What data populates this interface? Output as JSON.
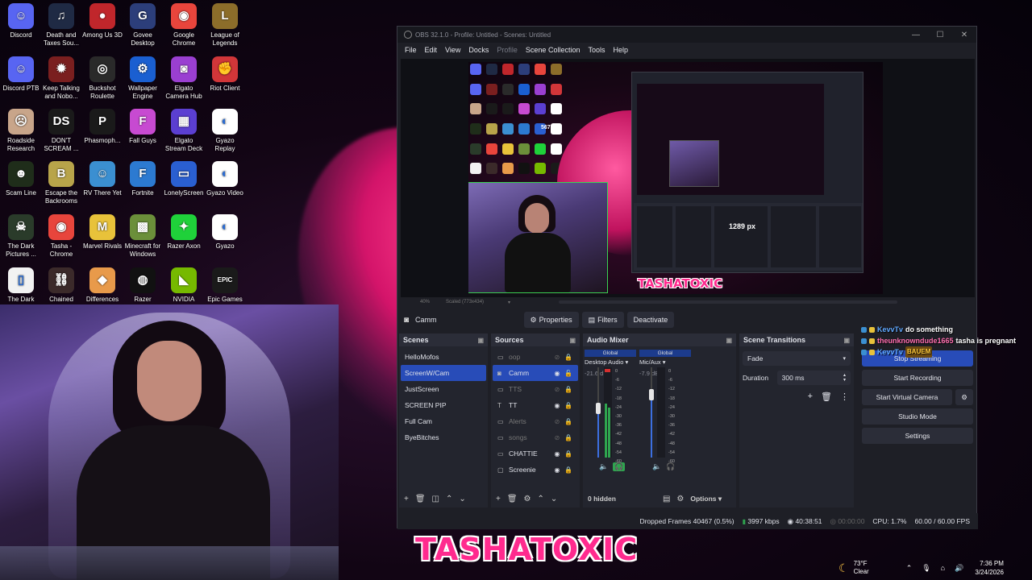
{
  "desktop": {
    "icons": [
      {
        "label": "Discord",
        "icon": "discord-icon",
        "color": "#5865f2",
        "glyph": "☺"
      },
      {
        "label": "Death and Taxes Sou...",
        "icon": "music-note-icon",
        "color": "#1f2a44",
        "glyph": "♫"
      },
      {
        "label": "Among Us 3D",
        "icon": "among-us-icon",
        "color": "#c0262b",
        "glyph": "●"
      },
      {
        "label": "Govee Desktop",
        "icon": "govee-icon",
        "color": "#2c3e7a",
        "glyph": "G"
      },
      {
        "label": "Google Chrome",
        "icon": "chrome-icon",
        "color": "#e8453c",
        "glyph": "◉"
      },
      {
        "label": "League of Legends",
        "icon": "league-icon",
        "color": "#8c6d2a",
        "glyph": "L"
      },
      {
        "label": "Discord PTB",
        "icon": "discord-ptb-icon",
        "color": "#5865f2",
        "glyph": "☺"
      },
      {
        "label": "Keep Talking and Nobo...",
        "icon": "bomb-icon",
        "color": "#7a1f1f",
        "glyph": "✹"
      },
      {
        "label": "Buckshot Roulette",
        "icon": "buckshot-icon",
        "color": "#2a2a2a",
        "glyph": "◎"
      },
      {
        "label": "Wallpaper Engine",
        "icon": "wallpaper-engine-icon",
        "color": "#1a5fd1",
        "glyph": "⚙"
      },
      {
        "label": "Elgato Camera Hub",
        "icon": "camera-hub-icon",
        "color": "#9a3fd1",
        "glyph": "◙"
      },
      {
        "label": "Riot Client",
        "icon": "riot-icon",
        "color": "#d13639",
        "glyph": "✊"
      },
      {
        "label": "Roadside Research",
        "icon": "roadside-icon",
        "color": "#c8a58a",
        "glyph": "☹"
      },
      {
        "label": "DON'T SCREAM ...",
        "icon": "dont-scream-icon",
        "color": "#1a1a1a",
        "glyph": "DS"
      },
      {
        "label": "Phasmoph...",
        "icon": "phasmophobia-icon",
        "color": "#1a1a1a",
        "glyph": "P"
      },
      {
        "label": "Fall Guys",
        "icon": "fall-guys-icon",
        "color": "#c74ad1",
        "glyph": "F"
      },
      {
        "label": "Elgato Stream Deck",
        "icon": "stream-deck-icon",
        "color": "#5b3fd1",
        "glyph": "▦"
      },
      {
        "label": "Gyazo Replay",
        "icon": "gyazo-replay-icon",
        "color": "#ffffff",
        "glyph": "◐"
      },
      {
        "label": "Scam Line",
        "icon": "scam-line-icon",
        "color": "#1f2d1a",
        "glyph": "☻"
      },
      {
        "label": "Escape the Backrooms",
        "icon": "backrooms-icon",
        "color": "#b8a44a",
        "glyph": "B"
      },
      {
        "label": "RV There Yet",
        "icon": "rv-there-yet-icon",
        "color": "#3b8fd1",
        "glyph": "☺"
      },
      {
        "label": "Fortnite",
        "icon": "fortnite-icon",
        "color": "#2c7ad1",
        "glyph": "F"
      },
      {
        "label": "LonelyScreen",
        "icon": "lonelyscreen-icon",
        "color": "#2a5fd1",
        "glyph": "▭"
      },
      {
        "label": "Gyazo Video",
        "icon": "gyazo-video-icon",
        "color": "#ffffff",
        "glyph": "◐"
      },
      {
        "label": "The Dark Pictures ...",
        "icon": "dark-pictures-icon",
        "color": "#2a3b2a",
        "glyph": "☠"
      },
      {
        "label": "Tasha - Chrome",
        "icon": "chrome-profile-icon",
        "color": "#e8453c",
        "glyph": "◉"
      },
      {
        "label": "Marvel Rivals",
        "icon": "marvel-rivals-icon",
        "color": "#e8c23a",
        "glyph": "M"
      },
      {
        "label": "Minecraft for Windows",
        "icon": "minecraft-icon",
        "color": "#6b8f3a",
        "glyph": "▩"
      },
      {
        "label": "Razer Axon",
        "icon": "razer-axon-icon",
        "color": "#1fd13a",
        "glyph": "✦"
      },
      {
        "label": "Gyazo",
        "icon": "gyazo-icon",
        "color": "#ffffff",
        "glyph": "◐"
      },
      {
        "label": "The Dark",
        "icon": "file-icon",
        "color": "#f2f2f2",
        "glyph": "▯"
      },
      {
        "label": "Chained",
        "icon": "chained-icon",
        "color": "#3b2a2a",
        "glyph": "⛓"
      },
      {
        "label": "Differences",
        "icon": "differences-icon",
        "color": "#e89a4a",
        "glyph": "◆"
      },
      {
        "label": "Razer",
        "icon": "razer-icon",
        "color": "#111111",
        "glyph": "◍"
      },
      {
        "label": "NVIDIA",
        "icon": "nvidia-icon",
        "color": "#76b900",
        "glyph": "◣"
      },
      {
        "label": "Epic Games",
        "icon": "epic-games-icon",
        "color": "#1a1a1a",
        "glyph": "EPIC"
      }
    ]
  },
  "overlay": {
    "brand": "TASHATOXIC"
  },
  "obs": {
    "title": "OBS 32.1.0 - Profile: Untitled - Scenes: Untitled",
    "menu": [
      "File",
      "Edit",
      "View",
      "Docks",
      "Profile",
      "Scene Collection",
      "Tools",
      "Help"
    ],
    "preview": {
      "zoom": "40%",
      "scaled": "Scaled (773x434)",
      "nested_label_1": "567 px",
      "nested_label_2": "1289 px",
      "brand": "TASHATOXIC"
    },
    "source_toolbar": {
      "source_name": "Camm",
      "properties": "Properties",
      "filters": "Filters",
      "deactivate": "Deactivate"
    },
    "scenes": {
      "title": "Scenes",
      "items": [
        "HelloMofos",
        "ScreenW/Cam",
        "JustScreen",
        "SCREEN PIP",
        "Full Cam",
        "ByeBitches"
      ],
      "active_index": 1
    },
    "sources": {
      "title": "Sources",
      "items": [
        {
          "name": "oop",
          "type": "browser",
          "visible": false,
          "locked": true
        },
        {
          "name": "Camm",
          "type": "camera",
          "visible": true,
          "locked": false
        },
        {
          "name": "TTS",
          "type": "browser",
          "visible": false,
          "locked": true
        },
        {
          "name": "TT",
          "type": "text",
          "visible": true,
          "locked": true
        },
        {
          "name": "Alerts",
          "type": "browser",
          "visible": false,
          "locked": true
        },
        {
          "name": "songs",
          "type": "browser",
          "visible": false,
          "locked": true
        },
        {
          "name": "CHATTIE",
          "type": "browser",
          "visible": true,
          "locked": true
        },
        {
          "name": "Screenie",
          "type": "display",
          "visible": true,
          "locked": true
        }
      ],
      "active_index": 1
    },
    "mixer": {
      "title": "Audio Mixer",
      "channels": [
        {
          "global": "Global",
          "name": "Desktop Audio",
          "db": "-21.6 dB",
          "level": 0.6,
          "fader": 0.55
        },
        {
          "global": "Global",
          "name": "Mic/Aux",
          "db": "-7.9 dB",
          "level": 0.0,
          "fader": 0.72
        }
      ],
      "scale": [
        "0",
        "-6",
        "-12",
        "-18",
        "-24",
        "-30",
        "-36",
        "-42",
        "-48",
        "-54",
        "-60"
      ],
      "hidden": "0 hidden",
      "options": "Options"
    },
    "transitions": {
      "title": "Scene Transitions",
      "type": "Fade",
      "duration_label": "Duration",
      "duration": "300 ms"
    },
    "controls": {
      "stream": "Stop Streaming",
      "record": "Start Recording",
      "virtual_cam": "Start Virtual Camera",
      "studio": "Studio Mode",
      "settings": "Settings"
    },
    "status": {
      "dropped": "Dropped Frames 40467 (0.5%)",
      "kbps": "3997 kbps",
      "live_time": "40:38:51",
      "rec_time": "00:00:00",
      "cpu": "CPU: 1.7%",
      "fps": "60.00 / 60.00 FPS"
    }
  },
  "chat": [
    {
      "user": "KevvTv",
      "message": "do something",
      "color": "#5fa8ff"
    },
    {
      "user": "theunknowndude1665",
      "message": "tasha is pregnant",
      "color": "#ff6fb0"
    },
    {
      "user": "KevvTv",
      "message": "BAUEM",
      "color": "#5fa8ff"
    }
  ],
  "taskbar": {
    "temp": "73°F",
    "weather": "Clear",
    "time": "7:36 PM",
    "date": "3/24/2026"
  }
}
